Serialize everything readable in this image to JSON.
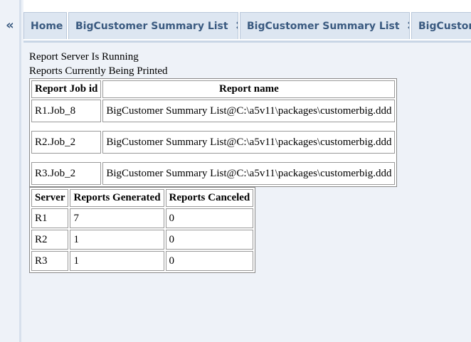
{
  "sidebar": {
    "collapse_glyph": "«"
  },
  "tabs": [
    {
      "label": "Home",
      "closable": false
    },
    {
      "label": "BigCustomer Summary List",
      "closable": true
    },
    {
      "label": "BigCustomer Summary List",
      "closable": true
    },
    {
      "label": "BigCustom",
      "closable": false
    }
  ],
  "close_glyph": "✖",
  "status": {
    "line1": "Report Server Is Running",
    "line2": "Reports Currently Being Printed"
  },
  "jobs_table": {
    "headers": [
      "Report Job id",
      "Report name"
    ],
    "rows": [
      [
        "R1.Job_8",
        "BigCustomer Summary List@C:\\a5v11\\packages\\customerbig.ddd"
      ],
      [
        "R2.Job_2",
        "BigCustomer Summary List@C:\\a5v11\\packages\\customerbig.ddd"
      ],
      [
        "R3.Job_2",
        "BigCustomer Summary List@C:\\a5v11\\packages\\customerbig.ddd"
      ]
    ]
  },
  "servers_table": {
    "headers": [
      "Server",
      "Reports Generated",
      "Reports Canceled"
    ],
    "rows": [
      [
        "R1",
        "7",
        "0"
      ],
      [
        "R2",
        "1",
        "0"
      ],
      [
        "R3",
        "1",
        "0"
      ]
    ]
  },
  "colors": {
    "tab_text": "#3a5a80",
    "tab_bg": "#dde6f1",
    "page_bg": "#eef2f8"
  }
}
